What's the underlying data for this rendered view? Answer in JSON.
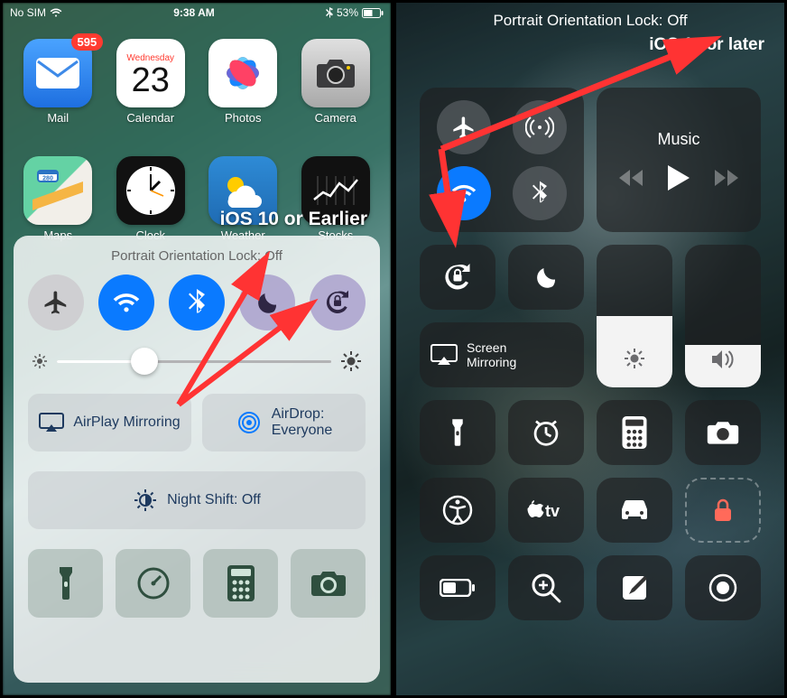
{
  "left": {
    "status": {
      "carrier": "No SIM",
      "time": "9:38 AM",
      "battery": "53%"
    },
    "apps_row1": [
      {
        "name": "Mail",
        "badge": "595"
      },
      {
        "name": "Calendar",
        "day": "Wednesday",
        "date": "23"
      },
      {
        "name": "Photos"
      },
      {
        "name": "Camera"
      }
    ],
    "apps_row2": [
      {
        "name": "Maps"
      },
      {
        "name": "Clock"
      },
      {
        "name": "Weather"
      },
      {
        "name": "Stocks"
      }
    ],
    "annotation": "iOS 10 or Earlier",
    "sheet": {
      "title": "Portrait Orientation Lock: Off",
      "toggles": [
        "airplane",
        "wifi",
        "bluetooth",
        "dnd",
        "orientation-lock"
      ],
      "airplay": "AirPlay Mirroring",
      "airdrop_label": "AirDrop:",
      "airdrop_value": "Everyone",
      "nightshift": "Night Shift: Off",
      "shortcuts": [
        "flashlight",
        "timer",
        "calculator",
        "camera"
      ]
    }
  },
  "right": {
    "title": "Portrait Orientation Lock: Off",
    "annotation": "iOS 11 or later",
    "connectivity": [
      "airplane",
      "cellular",
      "wifi",
      "bluetooth"
    ],
    "music": {
      "title": "Music"
    },
    "tiles_row2": [
      "orientation-lock",
      "dnd"
    ],
    "screen_mirroring": "Screen\nMirroring",
    "brightness_pct": 50,
    "volume_pct": 30,
    "tiles_row4": [
      "flashlight",
      "timer",
      "calculator",
      "camera"
    ],
    "tiles_row5": [
      "accessibility",
      "apple-tv",
      "carplay",
      "lock"
    ],
    "tiles_row6": [
      "low-power",
      "magnifier",
      "notes",
      "screen-record"
    ]
  }
}
